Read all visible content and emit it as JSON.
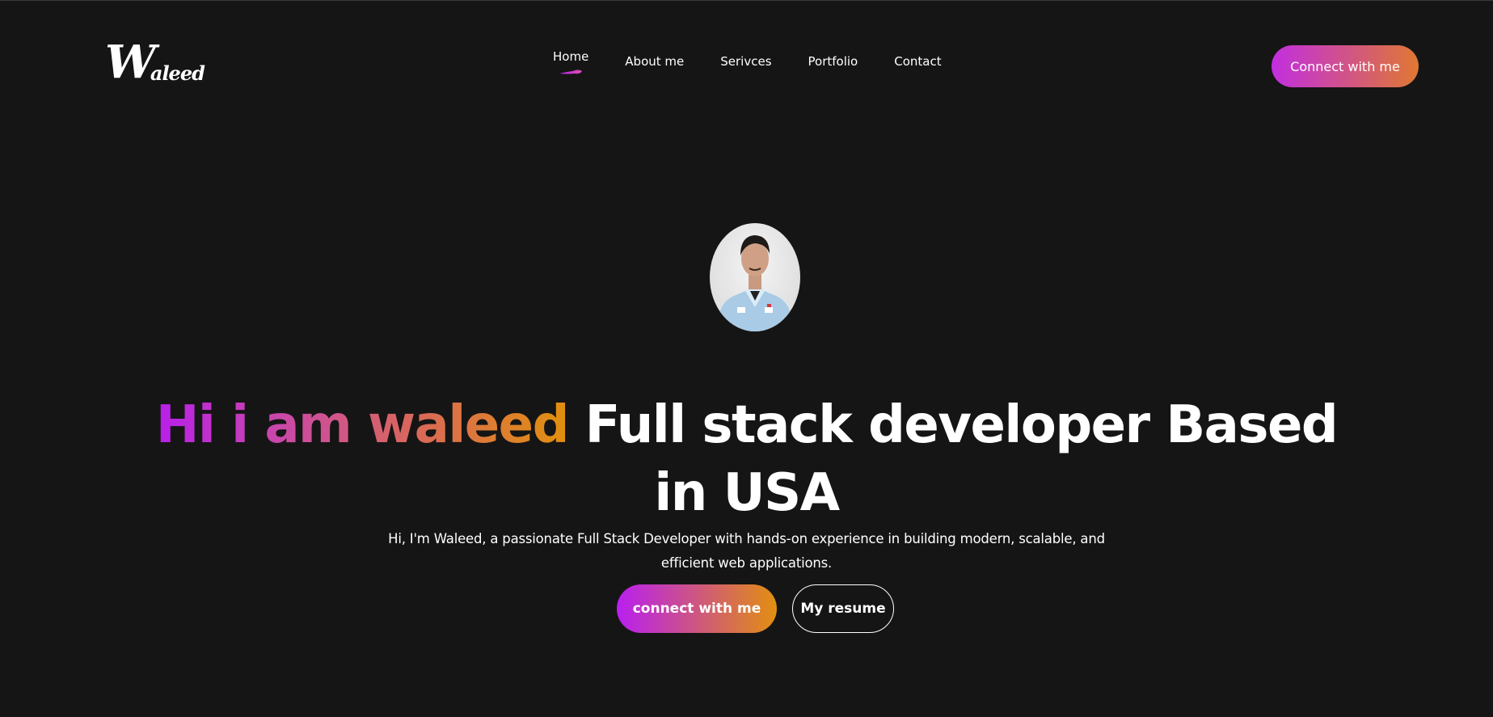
{
  "logo": {
    "big": "W",
    "small": "aleed"
  },
  "nav": {
    "items": [
      {
        "label": "Home",
        "active": true
      },
      {
        "label": "About me"
      },
      {
        "label": "Serivces"
      },
      {
        "label": "Portfolio"
      },
      {
        "label": "Contact"
      }
    ]
  },
  "header": {
    "cta_label": "Connect with me"
  },
  "hero": {
    "avatar_icon": "profile-photo",
    "headline_gradient": "Hi i am waleed",
    "headline_line1_rest": "Full stack developer Based",
    "headline_line2": "in USA",
    "subtitle": "Hi, I'm Waleed, a passionate Full Stack Developer with hands-on experience in building modern, scalable, and efficient web applications.",
    "primary_button": "connect with me",
    "secondary_button": "My resume"
  },
  "colors": {
    "background": "#161515",
    "accent_start": "#b81fea",
    "accent_end": "#e0900e"
  }
}
